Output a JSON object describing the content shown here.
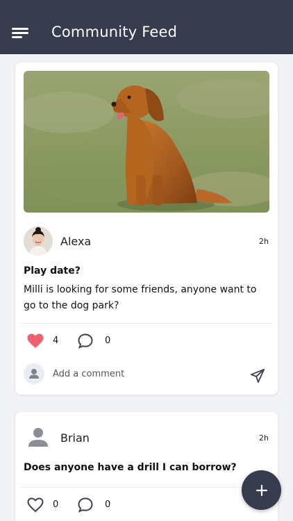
{
  "app": {
    "title": "Community Feed"
  },
  "posts": [
    {
      "author": "Alexa",
      "time": "2h",
      "title": "Play date?",
      "body": "Milli is looking for some friends, anyone want to go to the dog park?",
      "likes": "4",
      "comments": "0",
      "liked": true
    },
    {
      "author": "Brian",
      "time": "2h",
      "title": "Does anyone have a drill I can borrow?",
      "likes": "0",
      "comments": "0",
      "liked": false
    }
  ],
  "comment_box": {
    "placeholder": "Add a comment"
  },
  "icons": {
    "menu": "menu-icon",
    "like": "heart-icon",
    "comment": "comment-icon",
    "send": "send-icon",
    "add": "plus-icon",
    "avatar_placeholder": "person-icon"
  },
  "colors": {
    "appbar": "#363b4d",
    "heart_active": "#f0606e",
    "icon_gray": "#3d4150",
    "placeholder_avatar": "#8b8e96"
  }
}
